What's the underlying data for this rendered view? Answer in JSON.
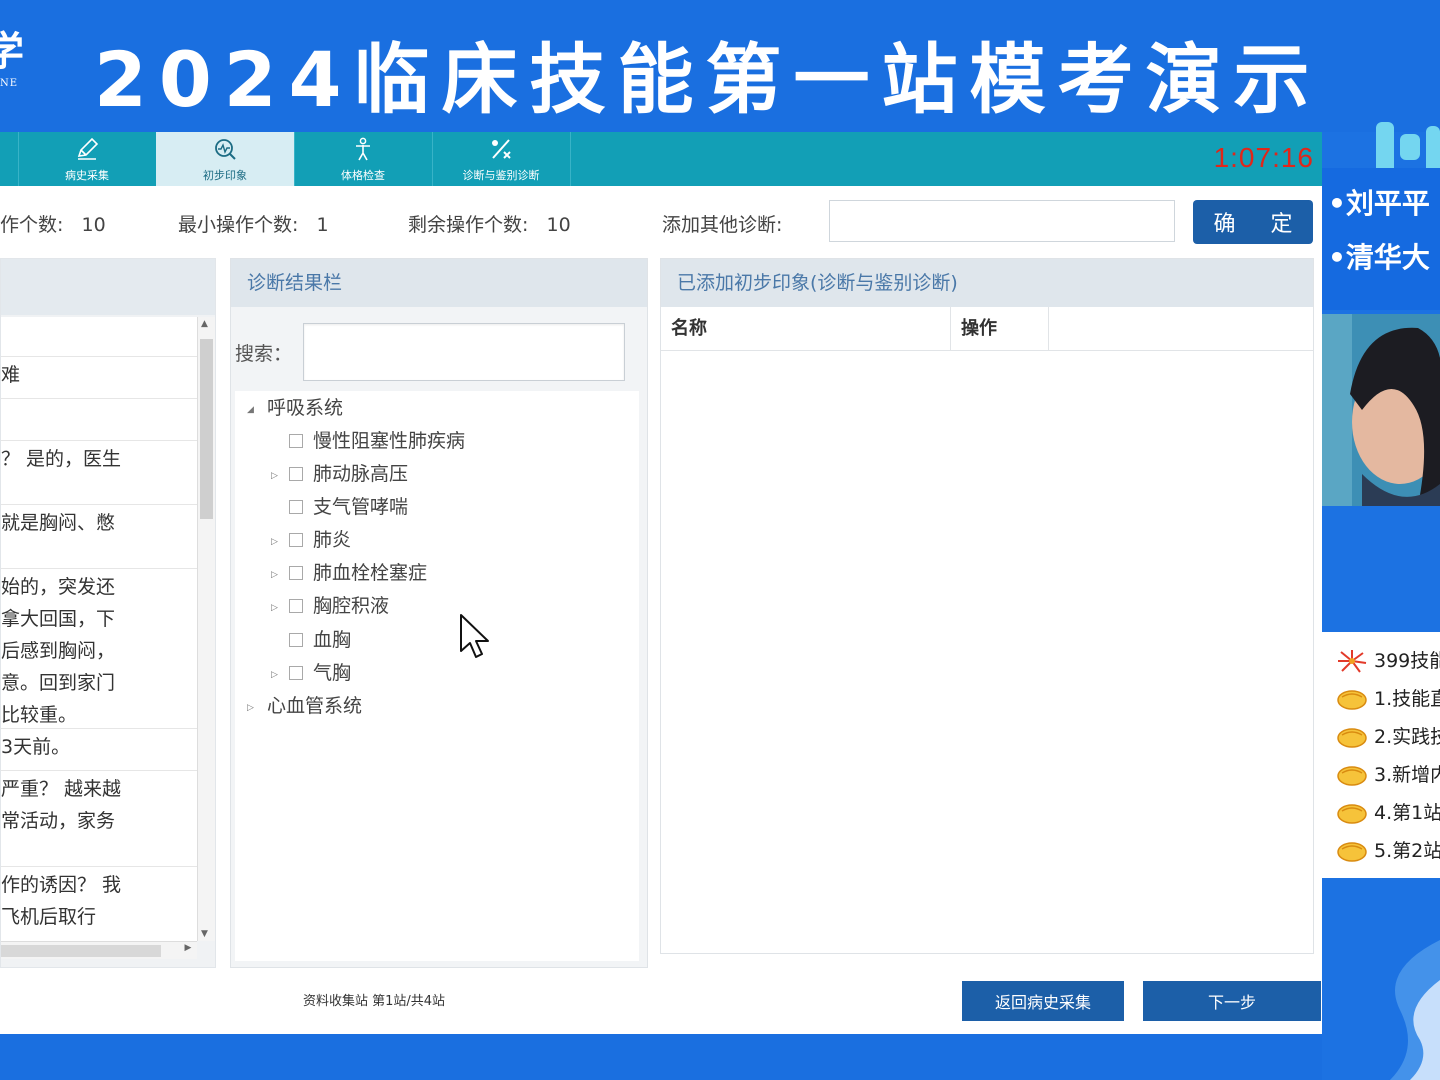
{
  "banner": {
    "title": "2024临床技能第一站模考演示",
    "logo_fragment": "学",
    "logo_fragment_small": "NE"
  },
  "toolbar": {
    "tabs": [
      {
        "label": "病史采集",
        "icon": "pencil-icon",
        "active": false
      },
      {
        "label": "初步印象",
        "icon": "diagnosis-search-icon",
        "active": true
      },
      {
        "label": "体格检查",
        "icon": "body-figure-icon",
        "active": false
      },
      {
        "label": "诊断与鉴别诊断",
        "icon": "percent-diagnosis-icon",
        "active": false
      }
    ],
    "timer": "1:07:16"
  },
  "ops": {
    "max_label": "作个数:",
    "max_value": "10",
    "min_label": "最小操作个数:",
    "min_value": "1",
    "remain_label": "剩余操作个数:",
    "remain_value": "10",
    "other_label": "添加其他诊断:",
    "other_value": "",
    "confirm": "确 定"
  },
  "chat": {
    "rows": [
      "",
      "难",
      "",
      "？ 是的，医生",
      " 就是胸闷、憋",
      "始的，突发还\n拿大回国，下\n后感到胸闷，\n意。回到家门\n比较重。",
      " 3天前。",
      "严重？ 越来越\n常活动，家务",
      "作的诱因？ 我\n飞机后取行"
    ]
  },
  "diagnosis": {
    "header": "诊断结果栏",
    "search_label": "搜索：",
    "search_value": "",
    "groups": [
      {
        "label": "呼吸系统",
        "expanded": true,
        "items": [
          {
            "label": "慢性阻塞性肺疾病",
            "has_children": false
          },
          {
            "label": "肺动脉高压",
            "has_children": true
          },
          {
            "label": "支气管哮喘",
            "has_children": false
          },
          {
            "label": "肺炎",
            "has_children": true
          },
          {
            "label": "肺血栓栓塞症",
            "has_children": true
          },
          {
            "label": "胸腔积液",
            "has_children": true
          },
          {
            "label": "血胸",
            "has_children": false
          },
          {
            "label": "气胸",
            "has_children": true
          }
        ]
      },
      {
        "label": "心血管系统",
        "expanded": false,
        "items": []
      }
    ]
  },
  "added": {
    "header": "已添加初步印象(诊断与鉴别诊断)",
    "col_name": "名称",
    "col_action": "操作",
    "rows": []
  },
  "footer": {
    "station": "资料收集站 第1站/共4站",
    "back": "返回病史采集",
    "next": "下一步"
  },
  "overlay": {
    "names": [
      "•刘平平",
      "•清华大"
    ],
    "promos": [
      {
        "text": "399技能",
        "icon": "firework-icon"
      },
      {
        "text": "1.技能直",
        "icon": "hand-pointer-icon"
      },
      {
        "text": "2.实践技",
        "icon": "hand-pointer-icon"
      },
      {
        "text": "3.新增内",
        "icon": "hand-pointer-icon"
      },
      {
        "text": "4.第1站",
        "icon": "hand-pointer-icon"
      },
      {
        "text": "5.第2站",
        "icon": "hand-pointer-icon"
      }
    ]
  },
  "colors": {
    "page_blue": "#1a6fe0",
    "toolbar_teal": "#129fb6",
    "button_blue": "#1c5fa8",
    "timer_red": "#e0261a"
  }
}
